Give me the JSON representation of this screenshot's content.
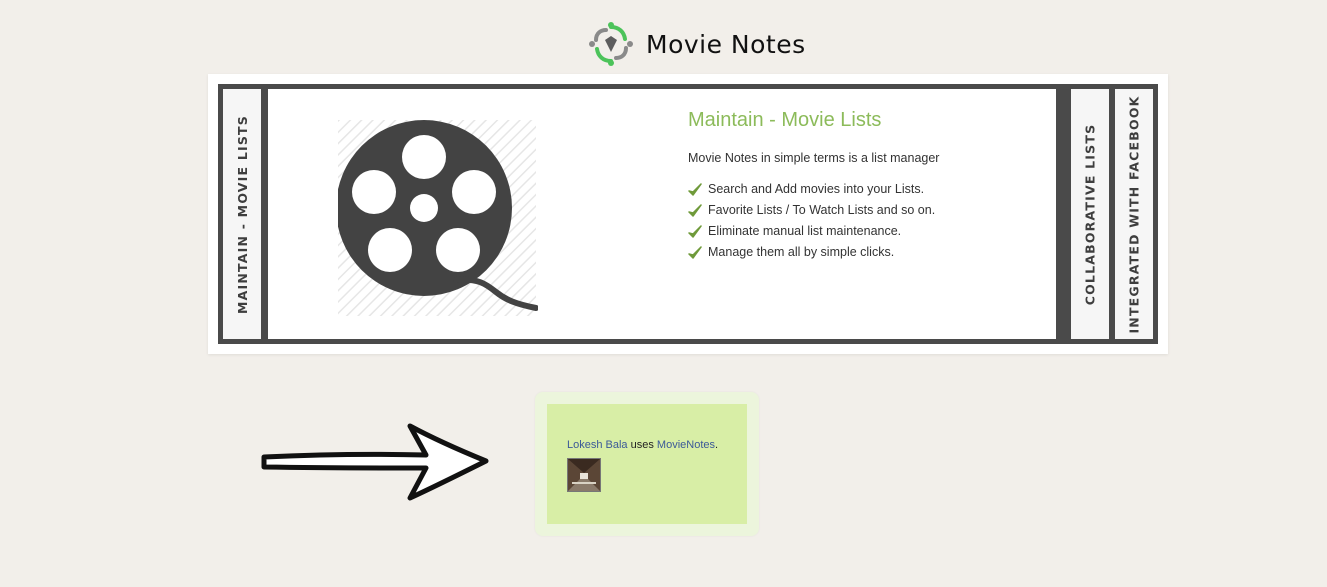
{
  "header": {
    "title": "Movie Notes",
    "logo_icon": "movie-notes-logo-icon"
  },
  "slider": {
    "tabs": [
      {
        "label": "MAINTAIN - MOVIE LISTS",
        "active": true
      },
      {
        "label": "COLLABORATIVE LISTS",
        "active": false
      },
      {
        "label": "INTEGRATED WITH FACEBOOK",
        "active": false
      }
    ],
    "panel": {
      "heading": "Maintain - Movie Lists",
      "intro": "Movie Notes in simple terms is a list manager",
      "features": [
        "Search and Add movies into your Lists.",
        "Favorite Lists / To Watch Lists and so on.",
        "Eliminate manual list maintenance.",
        "Manage them all by simple clicks."
      ],
      "image_icon": "film-reel-icon"
    }
  },
  "facebook_box": {
    "user": "Lokesh Bala",
    "verb": "uses",
    "app": "MovieNotes",
    "suffix": "."
  },
  "colors": {
    "accent_green": "#8cbb5a",
    "frame_dark": "#4a4a4a",
    "background": "#f2efea",
    "fb_box": "#d8eea6",
    "link": "#3b5998"
  }
}
